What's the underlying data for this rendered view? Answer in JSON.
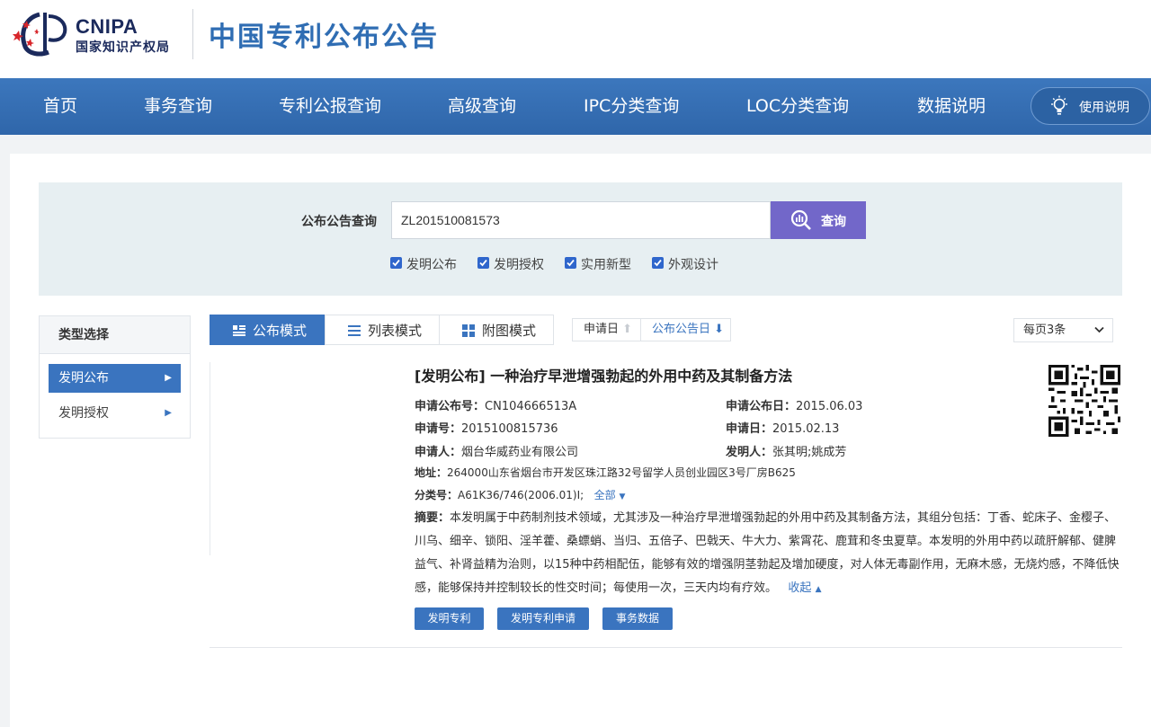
{
  "header": {
    "logo_en": "CNIPA",
    "logo_cn": "国家知识产权局",
    "site_title": "中国专利公布公告"
  },
  "nav": {
    "items": [
      "首页",
      "事务查询",
      "专利公报查询",
      "高级查询",
      "IPC分类查询",
      "LOC分类查询",
      "数据说明"
    ],
    "help_label": "使用说明"
  },
  "search": {
    "label": "公布公告查询",
    "value": "ZL201510081573",
    "button_label": "查询",
    "checkboxes": [
      {
        "label": "发明公布",
        "checked": true
      },
      {
        "label": "发明授权",
        "checked": true
      },
      {
        "label": "实用新型",
        "checked": true
      },
      {
        "label": "外观设计",
        "checked": true
      }
    ]
  },
  "sidebar": {
    "title": "类型选择",
    "items": [
      {
        "label": "发明公布",
        "active": true
      },
      {
        "label": "发明授权",
        "active": false
      }
    ]
  },
  "view_tabs": [
    {
      "label": "公布模式",
      "active": true
    },
    {
      "label": "列表模式",
      "active": false
    },
    {
      "label": "附图模式",
      "active": false
    }
  ],
  "sort": {
    "apply_date": "申请日",
    "pub_date": "公布公告日"
  },
  "page_size": "每页3条",
  "result": {
    "title": "[发明公布] 一种治疗早泄增强勃起的外用中药及其制备方法",
    "pub_no_label": "申请公布号：",
    "pub_no": "CN104666513A",
    "pub_date_label": "申请公布日：",
    "pub_date": "2015.06.03",
    "app_no_label": "申请号：",
    "app_no": "2015100815736",
    "app_date_label": "申请日：",
    "app_date": "2015.02.13",
    "applicant_label": "申请人：",
    "applicant": "烟台华威药业有限公司",
    "inventor_label": "发明人：",
    "inventor": "张其明;姚成芳",
    "address_label": "地址：",
    "address": "264000山东省烟台市开发区珠江路32号留学人员创业园区3号厂房B625",
    "class_label": "分类号：",
    "class": "A61K36/746(2006.01)I;",
    "all_link": "全部",
    "abstract_label": "摘要：",
    "abstract": "本发明属于中药制剂技术领域，尤其涉及一种治疗早泄增强勃起的外用中药及其制备方法，其组分包括：丁香、蛇床子、金樱子、川乌、细辛、锁阳、淫羊藿、桑螵蛸、当归、五倍子、巴戟天、牛大力、紫霄花、鹿茸和冬虫夏草。本发明的外用中药以疏肝解郁、健脾益气、补肾益精为治则，以15种中药相配伍，能够有效的增强阴茎勃起及增加硬度，对人体无毒副作用，无麻木感，无烧灼感，不降低快感，能够保持并控制较长的性交时间；每使用一次，三天内均有疗效。",
    "collapse_link": "收起",
    "actions": [
      "发明专利",
      "发明专利申请",
      "事务数据"
    ]
  },
  "colors": {
    "nav": "#3a74bf",
    "title": "#2f6db3",
    "search_button": "#7267c9",
    "action": "#3a74bf"
  }
}
